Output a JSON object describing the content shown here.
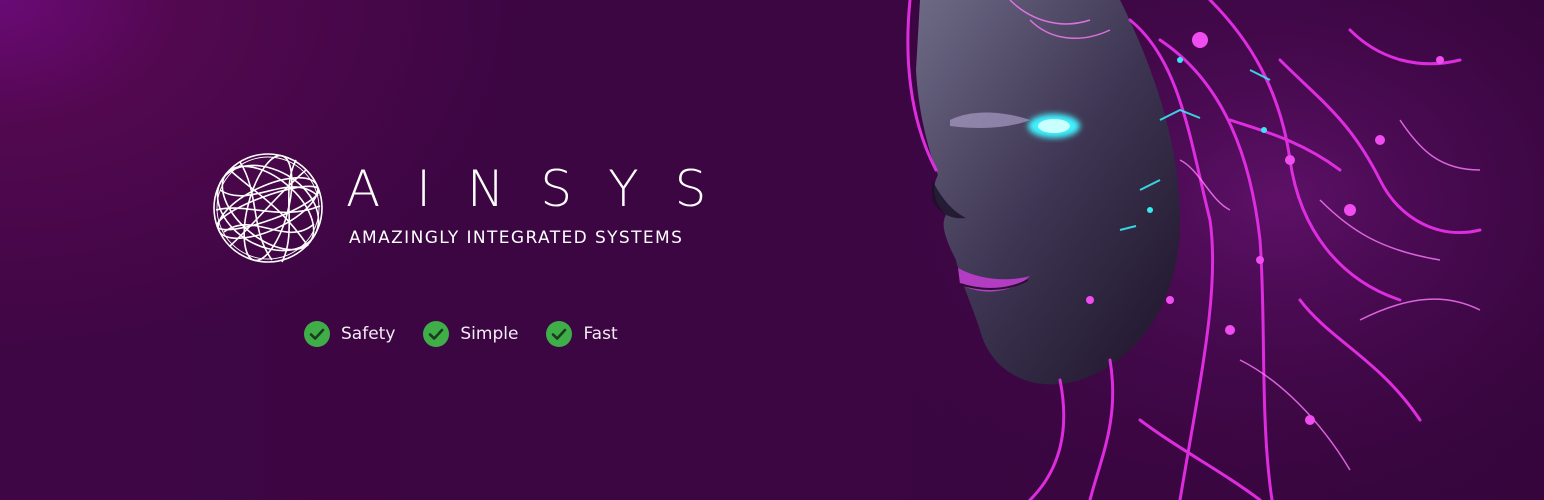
{
  "brand": {
    "name": "AINSYS",
    "tagline": "AMAZINGLY INTEGRATED SYSTEMS",
    "logo_icon": "wireframe-globe-icon"
  },
  "features": [
    {
      "label": "Safety",
      "icon": "check-circle-icon"
    },
    {
      "label": "Simple",
      "icon": "check-circle-icon"
    },
    {
      "label": "Fast",
      "icon": "check-circle-icon"
    }
  ],
  "colors": {
    "background": "#3b0642",
    "background_glow": "#6a0a76",
    "text": "#ffffff",
    "check": "#3fae49",
    "neon_pink": "#e62fe6",
    "neon_cyan": "#38e8f0"
  }
}
